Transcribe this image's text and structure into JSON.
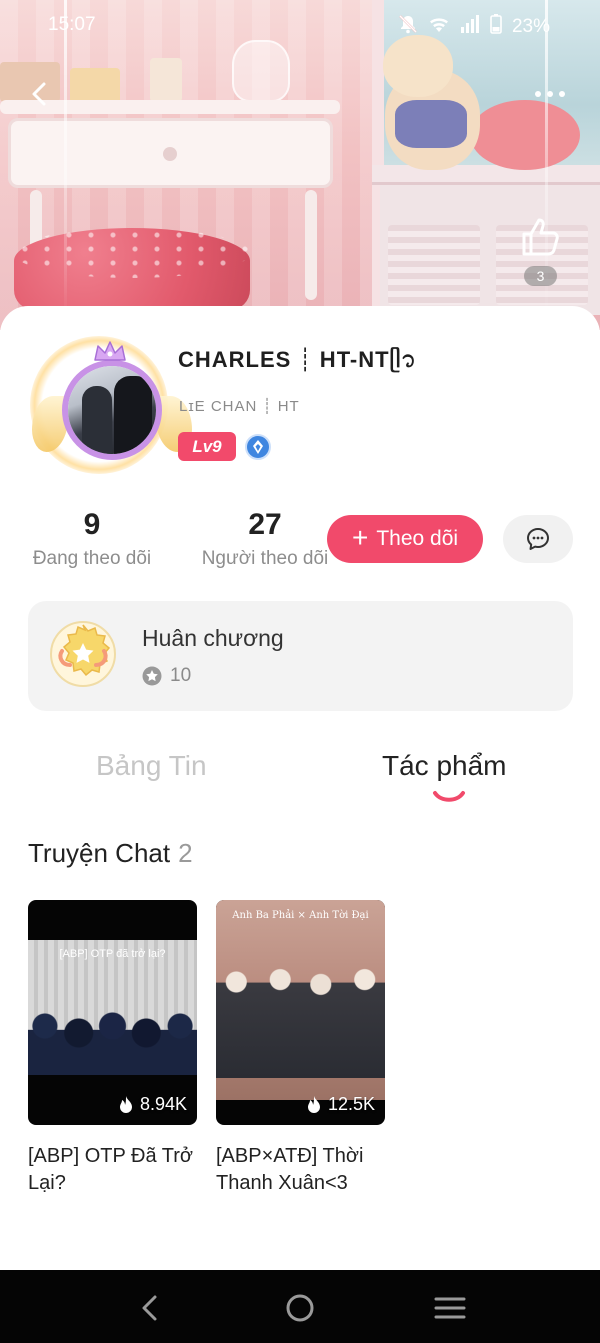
{
  "status_bar": {
    "time": "15:07",
    "battery": "23%",
    "icons": [
      "silent-bell-icon",
      "wifi-icon",
      "signal-icon",
      "battery-icon"
    ]
  },
  "header": {
    "like_count": "3"
  },
  "profile": {
    "display_name": "CHARLES ┊ HT-NTᥫ᭡",
    "handle": "LɪE CHAN ┊ HT",
    "level": "Lv9",
    "following_count": "9",
    "following_label": "Đang theo dõi",
    "followers_count": "27",
    "followers_label": "Người theo dõi",
    "follow_button": "Theo dõi",
    "follow_plus": "+"
  },
  "medal": {
    "title": "Huân chương",
    "count": "10"
  },
  "tabs": [
    {
      "label": "Bảng Tin",
      "active": false
    },
    {
      "label": "Tác phẩm",
      "active": true
    }
  ],
  "section": {
    "title": "Truyện Chat",
    "count": "2"
  },
  "stories": [
    {
      "title": "[ABP] OTP Đã Trở Lại?",
      "views": "8.94K",
      "thumb_caption": "[ABP] OTP đã trở lại?"
    },
    {
      "title": "[ABP×ATĐ] Thời Thanh Xuân<3",
      "views": "12.5K",
      "thumb_caption": "Anh Ba Phải × Anh Tời Đại"
    }
  ],
  "colors": {
    "accent": "#f14a6b",
    "level_badge": "#f24a6b",
    "verify_badge": "#3f86e0"
  }
}
